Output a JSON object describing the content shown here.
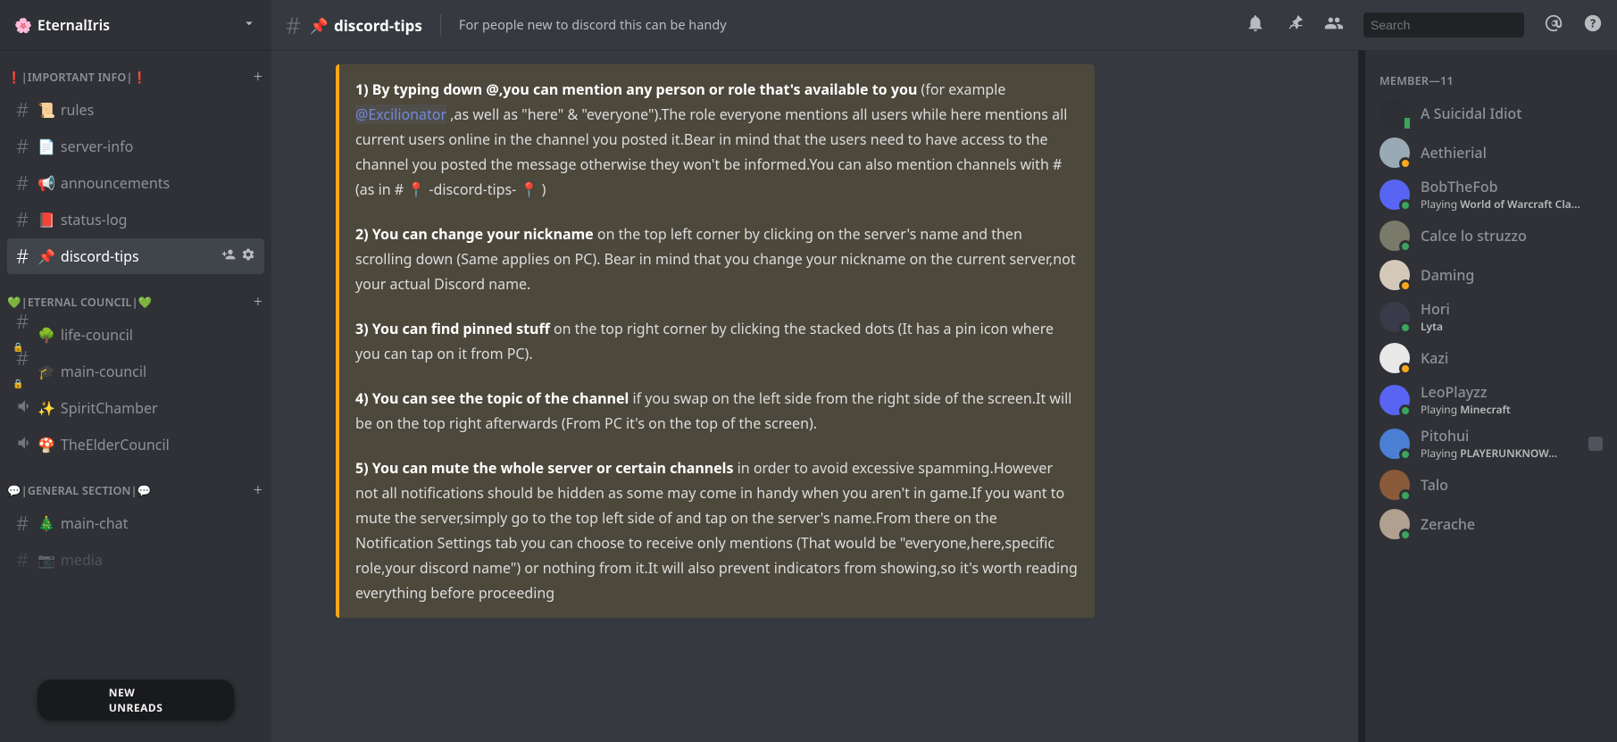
{
  "server": {
    "icon": "🌸",
    "name": "EternalIris"
  },
  "categories": [
    {
      "label": "❗|IMPORTANT INFO|❗",
      "em_color": "#ed4245",
      "channels": [
        {
          "icon": "📜",
          "name": "rules",
          "type": "text"
        },
        {
          "icon": "📄",
          "name": "server-info",
          "type": "text"
        },
        {
          "icon": "📢",
          "name": "announcements",
          "type": "text"
        },
        {
          "icon": "📕",
          "name": "status-log",
          "type": "text"
        },
        {
          "icon": "📌",
          "name": "discord-tips",
          "type": "text",
          "selected": true
        }
      ]
    },
    {
      "label": "💚|ETERNAL COUNCIL|💚",
      "em_color": "#3ba55d",
      "channels": [
        {
          "icon": "🌳",
          "name": "life-council",
          "type": "text",
          "locked": true
        },
        {
          "icon": "🎓",
          "name": "main-council",
          "type": "text",
          "locked": true
        },
        {
          "icon": "✨",
          "name": "SpiritChamber",
          "type": "voice"
        },
        {
          "icon": "🍄",
          "name": "TheElderCouncil",
          "type": "voice"
        }
      ]
    },
    {
      "label": "💬|GENERAL SECTION|💬",
      "em_color": "#8e9297",
      "channels": [
        {
          "icon": "🎄",
          "name": "main-chat",
          "type": "text"
        },
        {
          "icon": "📷",
          "name": "media",
          "type": "text",
          "faded": true
        }
      ]
    }
  ],
  "new_unreads": "NEW UNREADS",
  "topbar": {
    "icon": "📌",
    "title": "discord-tips",
    "topic": "For people new to discord this can be handy",
    "search_placeholder": "Search"
  },
  "message": {
    "tip1_bold": "1) By typing down @,you can mention any person or role that's available to you",
    "tip1_rest1": " (for example ",
    "tip1_mention": "@Excilionator",
    "tip1_rest2": "  ,as well as \"here\" & \"everyone\").The role everyone mentions all users while here mentions all current users online in the channel you posted it.Bear in mind that the users need to have access to the channel you posted the message otherwise they won't be informed.You can also mention channels  with # (as in # 📍 -discord-tips- 📍 )",
    "tip2_bold": "2) You can change your nickname",
    "tip2_rest": " on the top left corner by clicking on the server's name and then scrolling down (Same applies on PC). Bear in mind that you change your nickname on the current server,not your actual Discord name.",
    "tip3_bold": "3) You can find pinned stuff",
    "tip3_rest": " on the top right corner by clicking the stacked dots (It has a pin icon where you can tap on it from PC).",
    "tip4_bold": "4) You can see the topic of the channel",
    "tip4_rest": " if you swap on the left side from the right side of the screen.It will be on the top right afterwards (From PC it's on the top of the screen).",
    "tip5_bold": "5) You can mute the whole server or certain channels",
    "tip5_rest": " in order to avoid excessive spamming.However not all notifications should be hidden as some may come in handy when you aren't in game.If you want to mute the server,simply go to the top left side of and tap on the server's name.From there on the Notification Settings tab you can choose to receive only mentions (That would be \"everyone,here,specific role,your discord name\") or nothing from it.It will also prevent indicators from showing,so it's worth reading everything before proceeding"
  },
  "members": {
    "header": "MEMBER—11",
    "list": [
      {
        "name": "A Suicidal Idiot",
        "color": "#8e9297",
        "status": "mobile",
        "avatar_bg": "#2c2f33"
      },
      {
        "name": "Aethierial",
        "color": "#8e9297",
        "status": "idle",
        "avatar_bg": "#99aab5"
      },
      {
        "name": "BobTheFob",
        "color": "#8e9297",
        "status": "online",
        "avatar_bg": "#5865f2",
        "activity_prefix": "Playing ",
        "activity": "World of Warcraft Cla..."
      },
      {
        "name": "Calce lo struzzo",
        "color": "#8e9297",
        "status": "online",
        "avatar_bg": "#7a7a6a"
      },
      {
        "name": "Daming",
        "color": "#8e9297",
        "status": "idle",
        "avatar_bg": "#d4c9b8"
      },
      {
        "name": "Hori",
        "color": "#8e9297",
        "status": "online",
        "avatar_bg": "#3a3a4a",
        "activity": "Lyta"
      },
      {
        "name": "Kazi",
        "color": "#8e9297",
        "status": "idle",
        "avatar_bg": "#e8e8e8"
      },
      {
        "name": "LeoPlayzz",
        "color": "#8e9297",
        "status": "online",
        "avatar_bg": "#5865f2",
        "activity_prefix": "Playing ",
        "activity": "Minecraft"
      },
      {
        "name": "Pitohui",
        "color": "#8e9297",
        "status": "online",
        "avatar_bg": "#4a7fd4",
        "activity_prefix": "Playing ",
        "activity": "PLAYERUNKNOW...",
        "rich": true
      },
      {
        "name": "Talo",
        "color": "#8e9297",
        "status": "online",
        "avatar_bg": "#8a5a3a"
      },
      {
        "name": "Zerache",
        "color": "#8e9297",
        "status": "online",
        "avatar_bg": "#b0a090"
      }
    ]
  }
}
